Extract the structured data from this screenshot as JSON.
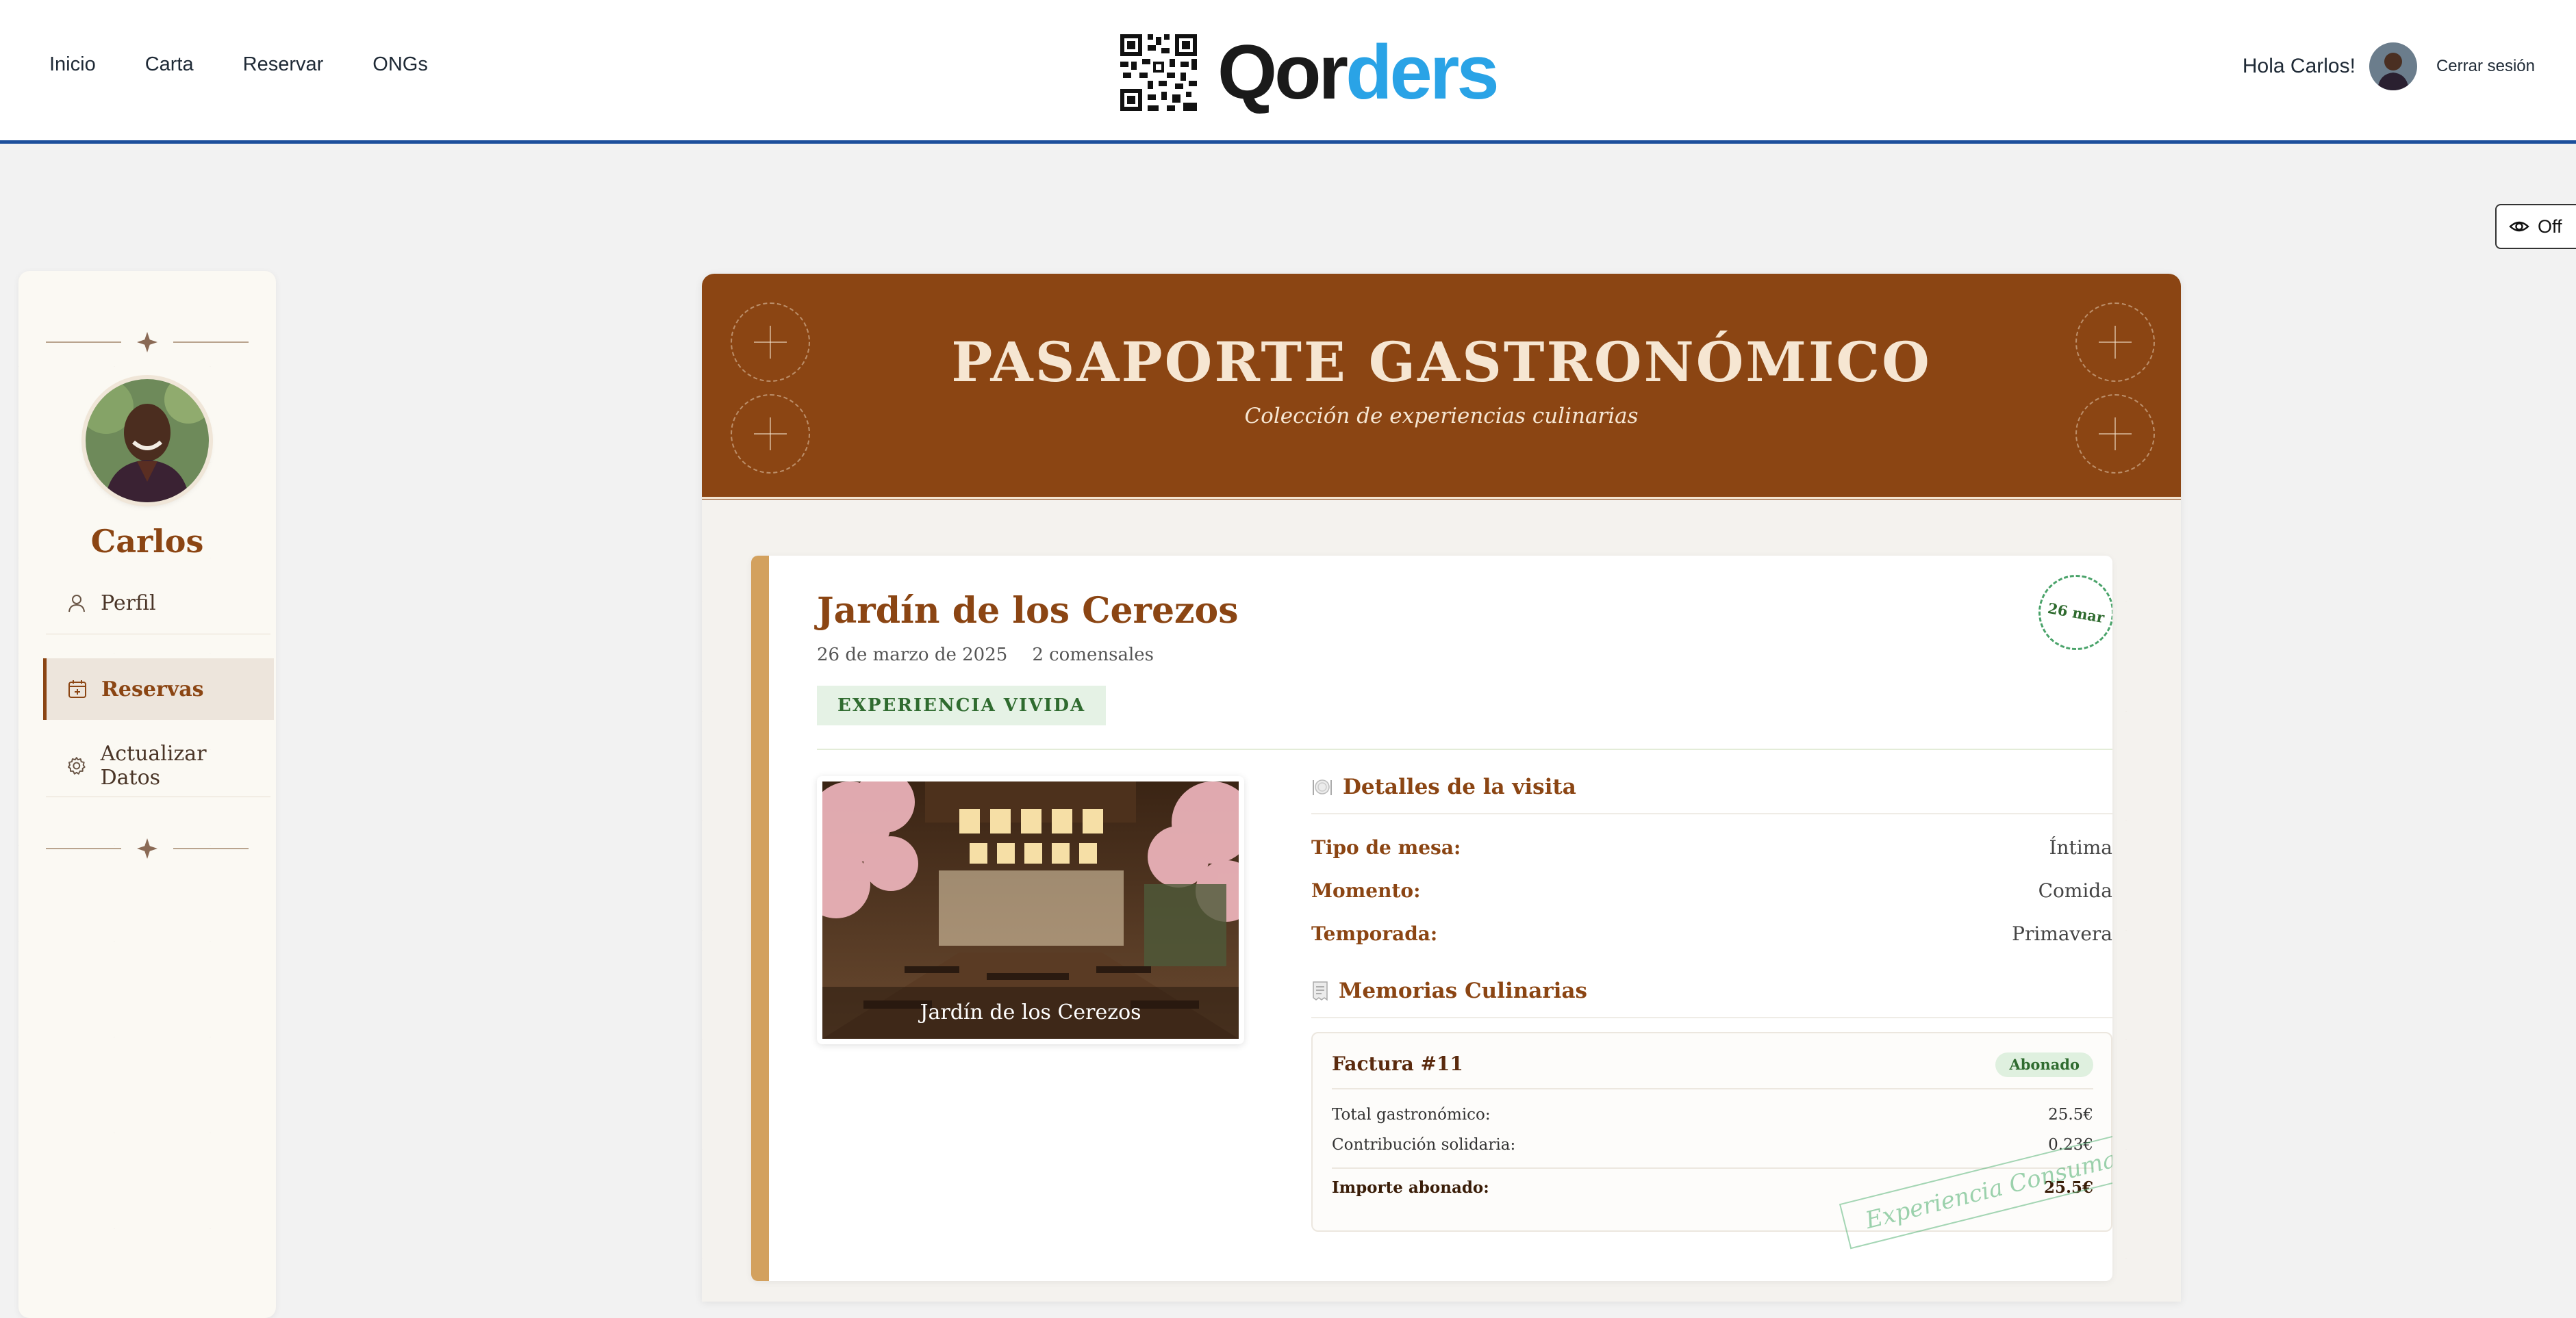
{
  "header": {
    "nav": [
      "Inicio",
      "Carta",
      "Reservar",
      "ONGs"
    ],
    "brand": {
      "part1": "Qor",
      "part2": "ders"
    },
    "greeting": "Hola Carlos!",
    "logout": "Cerrar sesión",
    "toggle_label": "Off"
  },
  "sidebar": {
    "name": "Carlos",
    "items": [
      {
        "label": "Perfil",
        "icon": "user-icon"
      },
      {
        "label": "Reservas",
        "icon": "calendar-icon",
        "active": true
      },
      {
        "label": "Actualizar Datos",
        "icon": "gear-icon"
      }
    ]
  },
  "passport": {
    "title": "PASAPORTE GASTRONÓMICO",
    "subtitle": "Colección de experiencias culinarias",
    "reservation": {
      "restaurant": "Jardín de los Cerezos",
      "date": "26 de marzo de 2025",
      "guests": "2 comensales",
      "status": "EXPERIENCIA VIVIDA",
      "stamp_date": "26 mar",
      "photo_caption": "Jardín de los Cerezos",
      "details_title": "Detalles de la visita",
      "details": [
        {
          "key": "Tipo de mesa:",
          "value": "Íntima"
        },
        {
          "key": "Momento:",
          "value": "Comida"
        },
        {
          "key": "Temporada:",
          "value": "Primavera"
        }
      ],
      "memories_title": "Memorias Culinarias",
      "invoice": {
        "title": "Factura #11",
        "badge": "Abonado",
        "rows": [
          {
            "label": "Total gastronómico:",
            "value": "25.5€"
          },
          {
            "label": "Contribución solidaria:",
            "value": "0.23€"
          }
        ],
        "total_label": "Importe abonado:",
        "total_value": "25.5€",
        "stamp": "Experiencia Consumada"
      }
    }
  },
  "colors": {
    "brand_blue": "#2aa3e6",
    "header_line": "#1d4f9c",
    "passport_brown": "#8b4513",
    "accent_gold": "#d3a15e",
    "success_green": "#2f6b2f"
  }
}
